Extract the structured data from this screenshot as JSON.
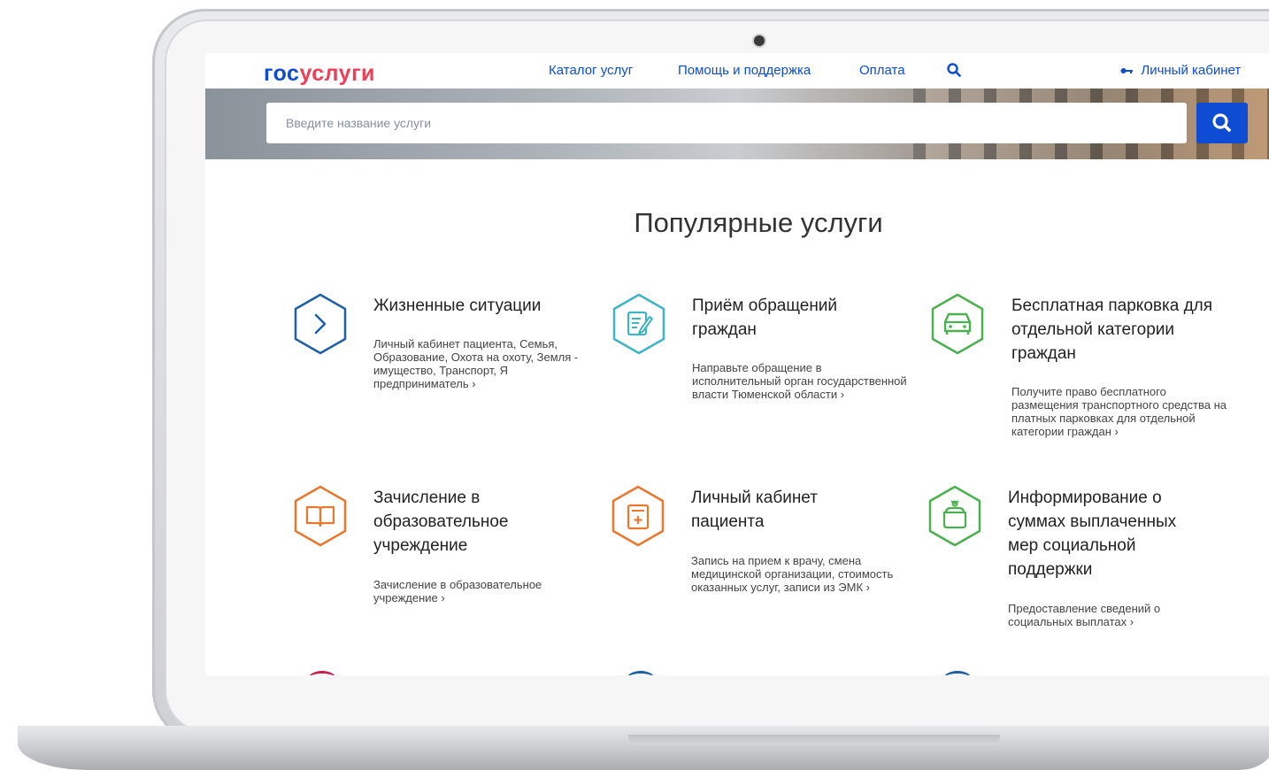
{
  "header": {
    "logo_part1": "гос",
    "logo_part2": "услуги",
    "nav": [
      "Каталог услуг",
      "Помощь и поддержка",
      "Оплата"
    ],
    "account_label": "Личный кабинет"
  },
  "search": {
    "placeholder": "Введите название услуги"
  },
  "main": {
    "title": "Популярные услуги",
    "cards": [
      {
        "title": "Жизненные ситуации",
        "desc": "Личный кабинет пациента, Семья, Образование, Охота на охоту, Земля - имущество, Транспорт, Я предприниматель ›",
        "icon": "chevron-right-icon",
        "color": "#1f5fa8"
      },
      {
        "title": "Приём обращений граждан",
        "desc": "Направьте обращение в исполнительный орган государственной власти Тюменской области ›",
        "icon": "edit-document-icon",
        "color": "#3fb4c3"
      },
      {
        "title": "Бесплатная парковка для отдельной категории граждан",
        "desc": "Получите право бесплатного размещения транспортного средства на платных парковках для отдельной категории граждан ›",
        "icon": "car-icon",
        "color": "#4caf50"
      },
      {
        "title": "Зачисление в образовательное учреждение",
        "desc": "Зачисление в образовательное учреждение ›",
        "icon": "book-icon",
        "color": "#e8782e"
      },
      {
        "title": "Личный кабинет пациента",
        "desc": "Запись на прием к врачу, смена медицинской организации, стоимость оказанных услуг, записи из ЭМК ›",
        "icon": "medical-record-icon",
        "color": "#e8782e"
      },
      {
        "title": "Информирование о суммах выплаченных мер социальной поддержки",
        "desc": "Предоставление сведений о социальных выплатах ›",
        "icon": "wallet-icon",
        "color": "#4caf50"
      }
    ]
  },
  "colors": {
    "brand_blue": "#0d4cd3",
    "brand_red": "#ee3f58"
  }
}
